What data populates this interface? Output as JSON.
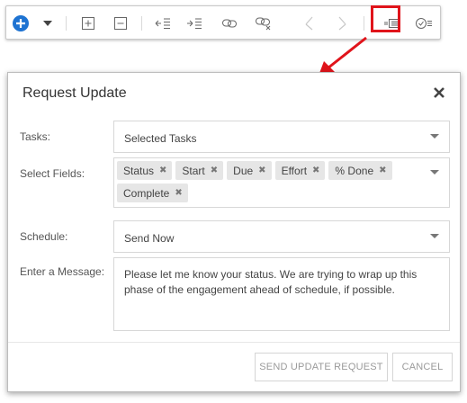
{
  "toolbar": {
    "buttons": [
      {
        "name": "add-icon"
      },
      {
        "name": "dropdown-arrow-icon"
      },
      {
        "name": "expand-icon"
      },
      {
        "name": "collapse-icon"
      },
      {
        "name": "outdent-icon"
      },
      {
        "name": "indent-icon"
      },
      {
        "name": "link-icon"
      },
      {
        "name": "unlink-icon"
      },
      {
        "name": "undo-icon"
      },
      {
        "name": "redo-icon"
      },
      {
        "name": "request-update-icon"
      },
      {
        "name": "status-icon"
      }
    ],
    "accent": "#1e73d2",
    "highlight_color": "#e0141b"
  },
  "dialog": {
    "title": "Request Update",
    "tasks": {
      "label": "Tasks:",
      "value": "Selected Tasks"
    },
    "fields": {
      "label": "Select Fields:",
      "tags": [
        "Status",
        "Start",
        "Due",
        "Effort",
        "% Done",
        "Complete"
      ]
    },
    "schedule": {
      "label": "Schedule:",
      "value": "Send Now"
    },
    "message": {
      "label": "Enter a Message:",
      "value": "Please let me know your status.  We are trying to wrap up this phase of the engagement ahead of schedule, if possible."
    },
    "send_label": "SEND UPDATE REQUEST",
    "cancel_label": "CANCEL"
  }
}
